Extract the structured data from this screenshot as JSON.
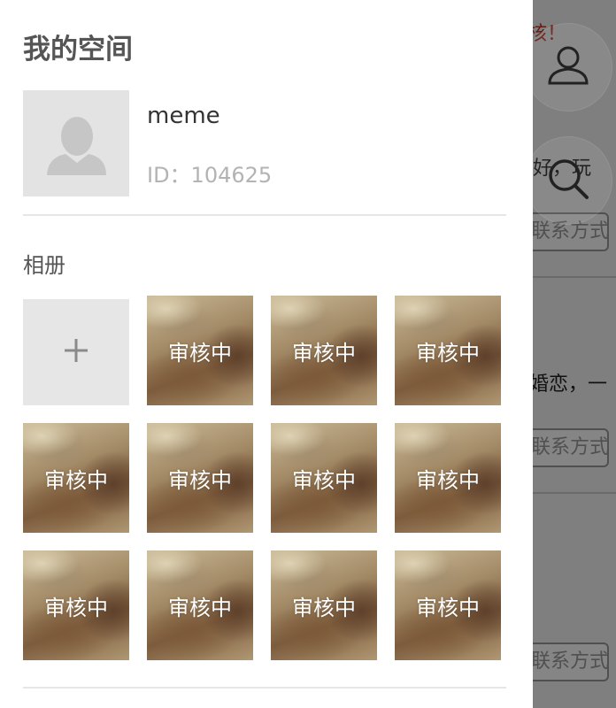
{
  "drawer": {
    "title": "我的空间",
    "username": "meme",
    "user_id": "ID：104625",
    "album_label": "相册",
    "add_symbol": "+"
  },
  "album": {
    "photos": [
      {
        "status": "审核中"
      },
      {
        "status": "审核中"
      },
      {
        "status": "审核中"
      },
      {
        "status": "审核中"
      },
      {
        "status": "审核中"
      },
      {
        "status": "审核中"
      },
      {
        "status": "审核中"
      },
      {
        "status": "审核中"
      },
      {
        "status": "审核中"
      },
      {
        "status": "审核中"
      },
      {
        "status": "审核中"
      }
    ]
  },
  "background": {
    "top_notice": "核！",
    "snippet_1": "好，玩",
    "snippet_2": "婚恋，一",
    "contact_button": "联系方式"
  },
  "icons": {
    "profile_fab": "user-icon",
    "search_fab": "search-icon",
    "avatar_placeholder": "person-placeholder-icon"
  },
  "colors": {
    "drawer_bg": "#ffffff",
    "overlay": "#7a7a7a",
    "notice_red": "#c0392b",
    "divider": "#e6e6e6"
  }
}
